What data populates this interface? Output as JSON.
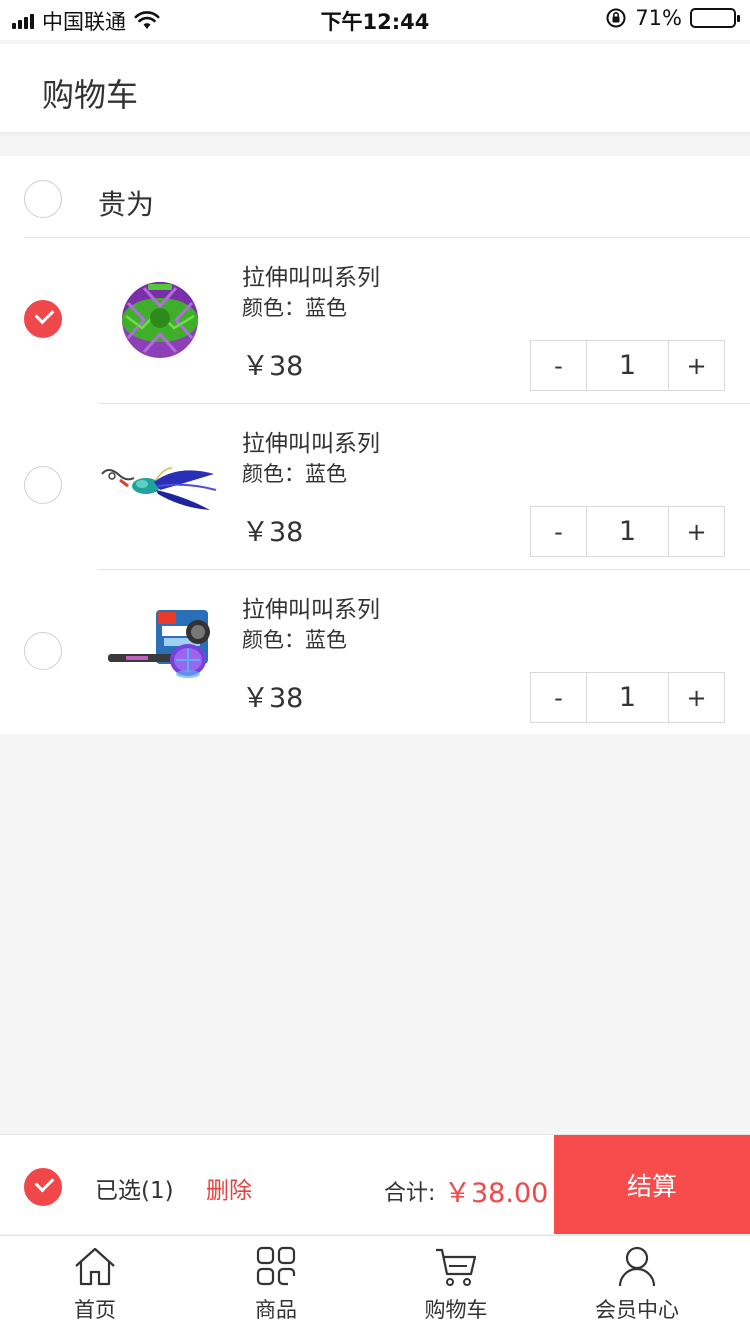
{
  "status_bar": {
    "carrier": "中国联通",
    "time": "下午12:44",
    "battery": "71%",
    "battery_level": 0.71,
    "icons": [
      "signal-icon",
      "wifi-icon",
      "orientation-lock-icon",
      "battery-icon"
    ]
  },
  "header": {
    "title": "购物车"
  },
  "shop": {
    "name": "贵为",
    "checked": false
  },
  "items": [
    {
      "name": "拉伸叫叫系列",
      "color": "颜色：蓝色",
      "price": "￥38",
      "qty": "1",
      "checked": true,
      "image": "green-purple-ball-toy"
    },
    {
      "name": "拉伸叫叫系列",
      "color": "颜色：蓝色",
      "price": "￥38",
      "qty": "1",
      "checked": false,
      "image": "feather-teaser-toy"
    },
    {
      "name": "拉伸叫叫系列",
      "color": "颜色：蓝色",
      "price": "￥38",
      "qty": "1",
      "checked": false,
      "image": "push-mute-squeaker-toy"
    }
  ],
  "stepper": {
    "minus": "-",
    "plus": "+"
  },
  "action_bar": {
    "selected": "已选(1)",
    "delete": "删除",
    "total_label": "合计:",
    "total_value": "￥38.00",
    "checkout": "结算",
    "all_checked": true
  },
  "tabs": [
    {
      "label": "首页",
      "icon": "home-icon"
    },
    {
      "label": "商品",
      "icon": "grid-icon"
    },
    {
      "label": "购物车",
      "icon": "cart-icon"
    },
    {
      "label": "会员中心",
      "icon": "user-icon"
    }
  ],
  "colors": {
    "accent": "#f0474b",
    "checkout_bg": "#f84c4c",
    "delete": "#e64340"
  }
}
